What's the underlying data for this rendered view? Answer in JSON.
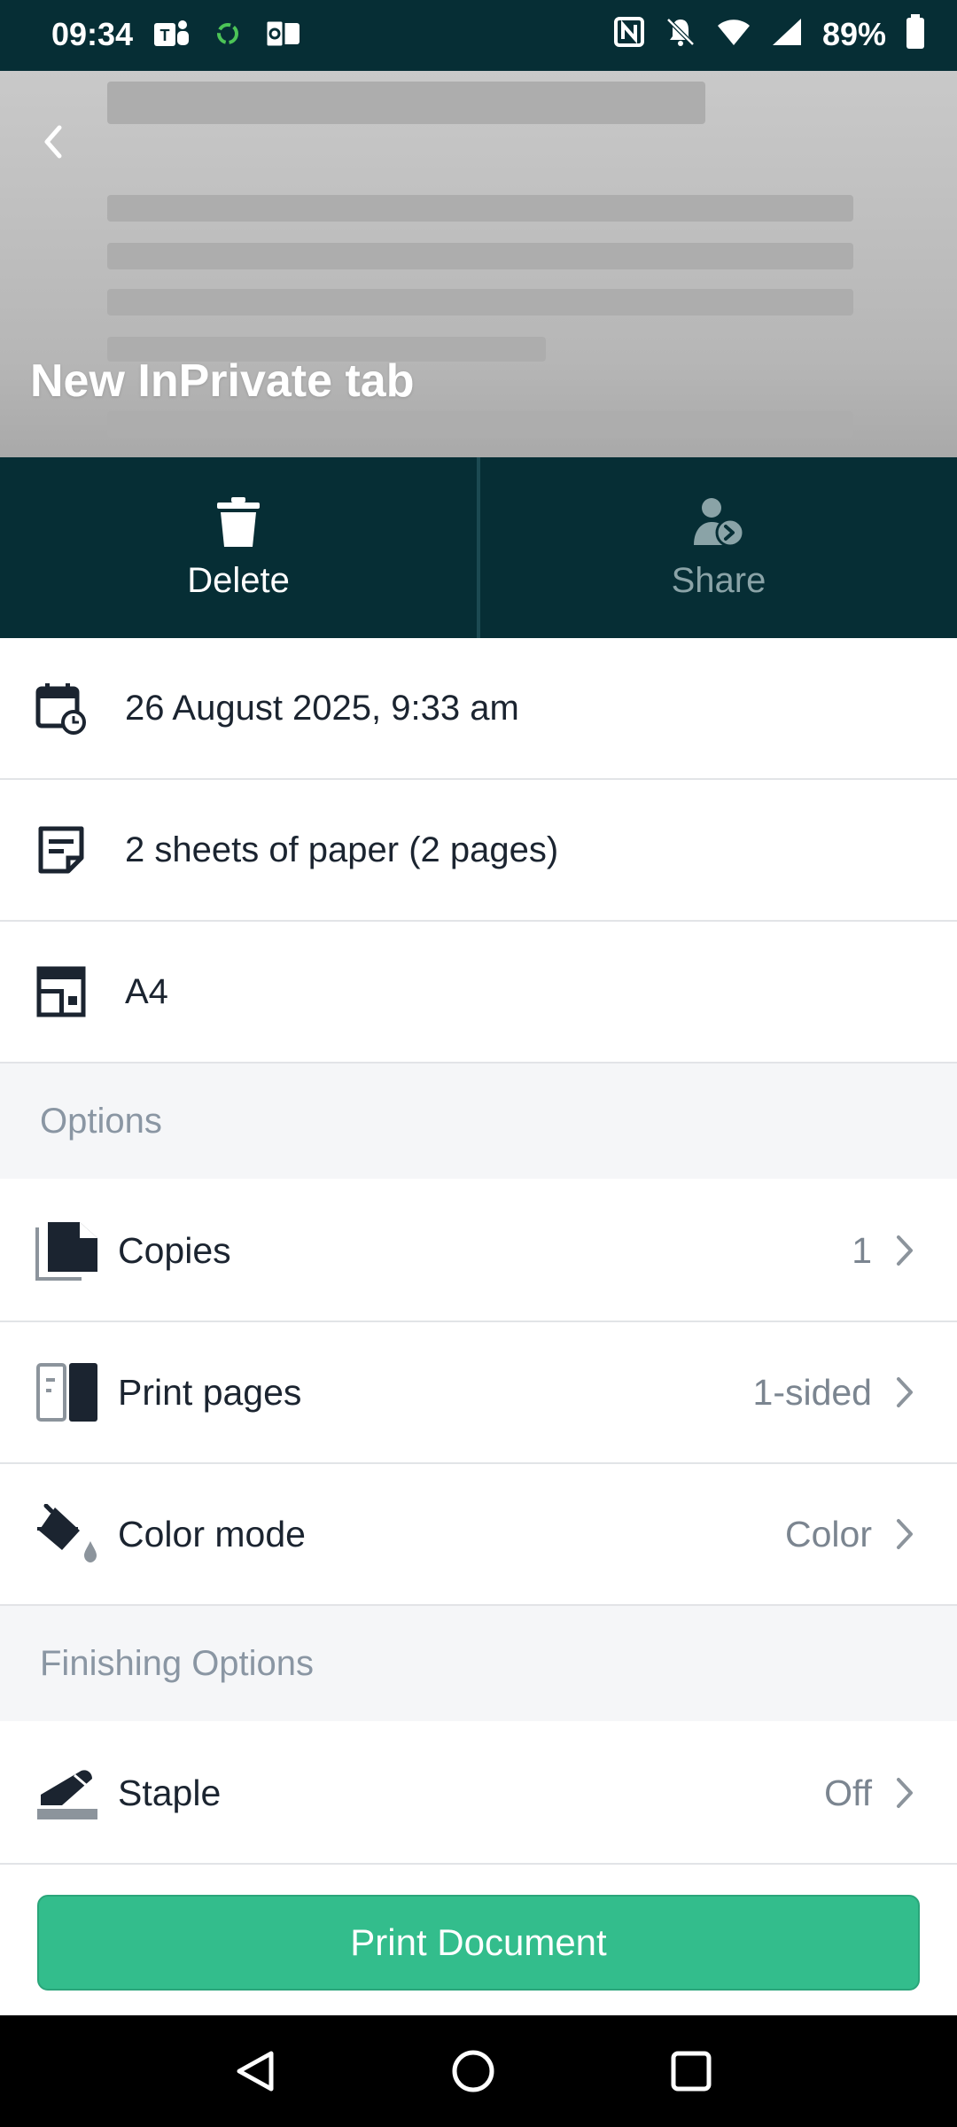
{
  "status_bar": {
    "time": "09:34",
    "left_icons": [
      "teams-icon",
      "sync-icon",
      "outlook-icon"
    ],
    "right_icons": [
      "nfc-icon",
      "mute-bell-icon",
      "wifi-icon",
      "signal-icon",
      "battery-icon"
    ],
    "battery": "89%"
  },
  "preview": {
    "title": "New InPrivate tab"
  },
  "actions": {
    "delete_label": "Delete",
    "share_label": "Share"
  },
  "info": {
    "date": "26 August 2025, 9:33 am",
    "sheets": "2 sheets of paper (2 pages)",
    "paper_size": "A4"
  },
  "sections": {
    "options": "Options",
    "finishing": "Finishing Options"
  },
  "options": [
    {
      "label": "Copies",
      "value": "1",
      "icon": "copies-icon"
    },
    {
      "label": "Print pages",
      "value": "1-sided",
      "icon": "print-pages-icon"
    },
    {
      "label": "Color mode",
      "value": "Color",
      "icon": "paint-bucket-icon"
    }
  ],
  "finishing": [
    {
      "label": "Staple",
      "value": "Off",
      "icon": "stapler-icon"
    }
  ],
  "print_button": "Print Document",
  "colors": {
    "header_bg": "#062e35",
    "accent_green": "#33bd8c",
    "text_dark": "#1b2430",
    "text_muted": "#7b8590"
  }
}
